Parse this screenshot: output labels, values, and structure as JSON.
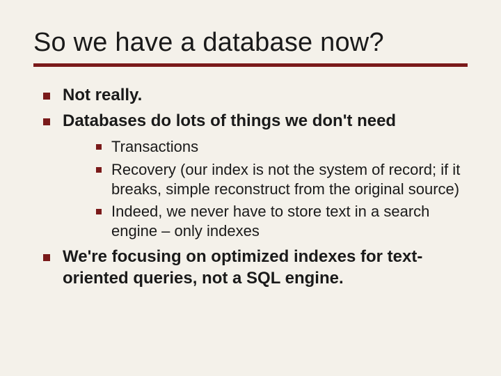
{
  "title": "So we have a database now?",
  "colors": {
    "accent": "#7a1a1a",
    "background": "#f4f1ea",
    "text": "#1a1a1a"
  },
  "bullets": {
    "a": "Not really.",
    "b": "Databases do lots of things we don't need",
    "b_sub": {
      "i": "Transactions",
      "ii": "Recovery (our index is not the system of record; if it breaks, simple reconstruct from the original source)",
      "iii": "Indeed, we never have to store text in a search engine – only indexes"
    },
    "c": "We're focusing on optimized indexes for text-oriented queries, not a SQL engine."
  }
}
